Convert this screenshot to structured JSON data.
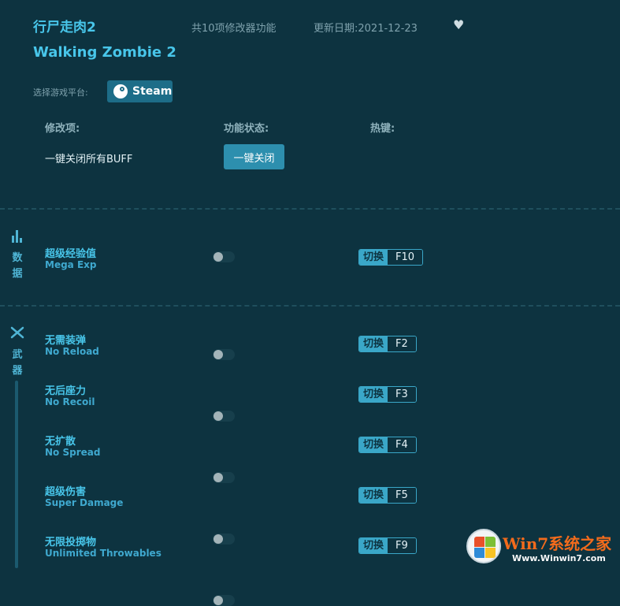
{
  "header": {
    "title_cn": "行尸走肉2",
    "title_en": "Walking Zombie 2",
    "cheat_count": "共10项修改器功能",
    "update_date": "更新日期:2021-12-23"
  },
  "platform": {
    "label": "选择游戏平台:",
    "steam_label": "Steam"
  },
  "columns": {
    "item": "修改项:",
    "status": "功能状态:",
    "hotkey": "热键:"
  },
  "global_row": {
    "label": "一键关闭所有BUFF",
    "button": "一键关闭"
  },
  "categories": [
    {
      "name_char1": "数",
      "name_char2": "据",
      "icon": "bar-chart-icon",
      "cheats": [
        {
          "cn": "超级经验值",
          "en": "Mega Exp",
          "hotkey_label": "切换",
          "key": "F10",
          "enabled": false
        }
      ]
    },
    {
      "name_char1": "武",
      "name_char2": "器",
      "icon": "crossed-swords-icon",
      "cheats": [
        {
          "cn": "无需装弹",
          "en": "No Reload",
          "hotkey_label": "切换",
          "key": "F2",
          "enabled": false
        },
        {
          "cn": "无后座力",
          "en": "No Recoil",
          "hotkey_label": "切换",
          "key": "F3",
          "enabled": false
        },
        {
          "cn": "无扩散",
          "en": "No Spread",
          "hotkey_label": "切换",
          "key": "F4",
          "enabled": false
        },
        {
          "cn": "超级伤害",
          "en": "Super Damage",
          "hotkey_label": "切换",
          "key": "F5",
          "enabled": false
        },
        {
          "cn": "无限投掷物",
          "en": "Unlimited Throwables",
          "hotkey_label": "切换",
          "key": "F9",
          "enabled": false
        }
      ]
    }
  ],
  "watermark": {
    "title": "Win7系统之家",
    "url": "Www.Winwin7.com"
  },
  "colors": {
    "background": "#0d3340",
    "accent": "#48c6ea",
    "button": "#2d8fae",
    "watermark_orange": "#f36b1c"
  }
}
